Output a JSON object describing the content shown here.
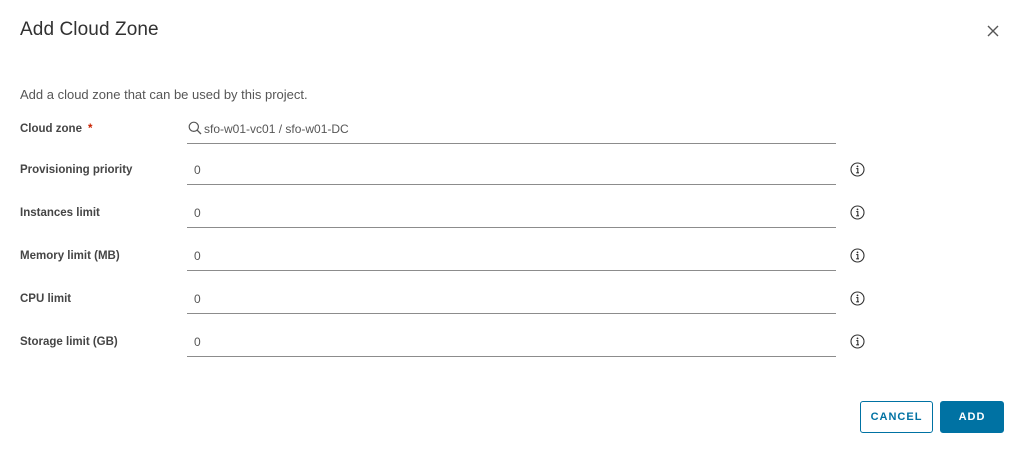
{
  "dialog": {
    "title": "Add Cloud Zone",
    "description": "Add a cloud zone that can be used by this project."
  },
  "form": {
    "cloud_zone": {
      "label": "Cloud zone",
      "required_marker": "*",
      "value": "sfo-w01-vc01 / sfo-w01-DC"
    },
    "provisioning_priority": {
      "label": "Provisioning priority",
      "value": "0"
    },
    "instances_limit": {
      "label": "Instances limit",
      "value": "0"
    },
    "memory_limit": {
      "label": "Memory limit (MB)",
      "value": "0"
    },
    "cpu_limit": {
      "label": "CPU limit",
      "value": "0"
    },
    "storage_limit": {
      "label": "Storage limit (GB)",
      "value": "0"
    }
  },
  "buttons": {
    "cancel": "CANCEL",
    "add": "ADD"
  },
  "icons": {
    "close": "close-icon",
    "search": "search-icon",
    "info": "info-icon"
  },
  "colors": {
    "primary": "#0072a3",
    "required": "#c92100",
    "text": "#313131"
  }
}
